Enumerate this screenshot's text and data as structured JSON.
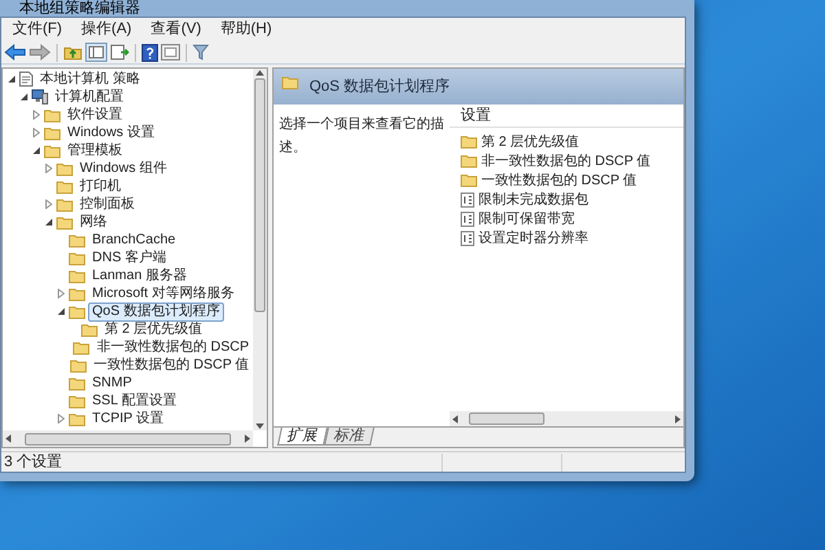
{
  "window": {
    "title": "本地组策略编辑器"
  },
  "menu": [
    "文件(F)",
    "操作(A)",
    "查看(V)",
    "帮助(H)"
  ],
  "tree": [
    {
      "label": "本地计算机 策略",
      "kind": "policy",
      "expanded": true,
      "selected": false,
      "children": [
        {
          "label": "计算机配置",
          "kind": "computer",
          "expanded": true,
          "selected": false,
          "children": [
            {
              "label": "软件设置",
              "kind": "folder",
              "expanded": false,
              "selected": false
            },
            {
              "label": "Windows 设置",
              "kind": "folder",
              "expanded": false,
              "selected": false
            },
            {
              "label": "管理模板",
              "kind": "folder",
              "expanded": true,
              "selected": false,
              "children": [
                {
                  "label": "Windows 组件",
                  "kind": "folder",
                  "expanded": false,
                  "selected": false
                },
                {
                  "label": "打印机",
                  "kind": "folder",
                  "selected": false
                },
                {
                  "label": "控制面板",
                  "kind": "folder",
                  "expanded": false,
                  "selected": false
                },
                {
                  "label": "网络",
                  "kind": "folder",
                  "expanded": true,
                  "selected": false,
                  "children": [
                    {
                      "label": "BranchCache",
                      "kind": "folder",
                      "selected": false
                    },
                    {
                      "label": "DNS 客户端",
                      "kind": "folder",
                      "selected": false
                    },
                    {
                      "label": "Lanman 服务器",
                      "kind": "folder",
                      "selected": false
                    },
                    {
                      "label": "Microsoft 对等网络服务",
                      "kind": "folder",
                      "expanded": false,
                      "selected": false
                    },
                    {
                      "label": "QoS 数据包计划程序",
                      "kind": "folder",
                      "expanded": true,
                      "selected": true,
                      "children": [
                        {
                          "label": "第 2 层优先级值",
                          "kind": "folder",
                          "selected": false
                        },
                        {
                          "label": "非一致性数据包的 DSCP",
                          "kind": "folder",
                          "selected": false
                        },
                        {
                          "label": "一致性数据包的 DSCP 值",
                          "kind": "folder",
                          "selected": false
                        }
                      ]
                    },
                    {
                      "label": "SNMP",
                      "kind": "folder",
                      "selected": false
                    },
                    {
                      "label": "SSL 配置设置",
                      "kind": "folder",
                      "selected": false
                    },
                    {
                      "label": "TCPIP 设置",
                      "kind": "folder",
                      "expanded": false,
                      "selected": false
                    }
                  ]
                }
              ]
            }
          ]
        }
      ]
    }
  ],
  "detail": {
    "title": "QoS 数据包计划程序",
    "description": "选择一个项目来查看它的描述。",
    "column": "设置",
    "items": [
      {
        "label": "第 2 层优先级值",
        "kind": "folder"
      },
      {
        "label": "非一致性数据包的 DSCP 值",
        "kind": "folder"
      },
      {
        "label": "一致性数据包的 DSCP 值",
        "kind": "folder"
      },
      {
        "label": "限制未完成数据包",
        "kind": "setting"
      },
      {
        "label": "限制可保留带宽",
        "kind": "setting"
      },
      {
        "label": "设置定时器分辨率",
        "kind": "setting"
      }
    ],
    "tabs": [
      {
        "label": "扩展",
        "selected": true
      },
      {
        "label": "标准",
        "selected": false
      }
    ]
  },
  "status_bar": "3 个设置"
}
